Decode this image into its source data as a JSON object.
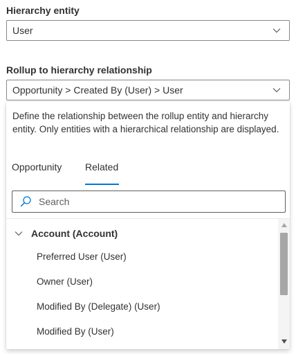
{
  "hierarchy_entity": {
    "label": "Hierarchy entity",
    "value": "User",
    "chevron_icon": "chevron-down-icon"
  },
  "rollup_relationship": {
    "label": "Rollup to hierarchy relationship",
    "value": "Opportunity > Created By (User) > User",
    "chevron_icon": "chevron-down-icon"
  },
  "flyout": {
    "description": "Define the relationship between the rollup entity and hierarchy entity. Only entities with a hierarchical relationship are displayed.",
    "tabs": [
      {
        "label": "Opportunity",
        "active": false
      },
      {
        "label": "Related",
        "active": true
      }
    ],
    "search": {
      "placeholder": "Search",
      "icon": "search-icon"
    },
    "groups": [
      {
        "label": "Account (Account)",
        "expanded": true,
        "items": [
          {
            "label": "Preferred User (User)"
          },
          {
            "label": "Owner (User)"
          },
          {
            "label": "Modified By (Delegate) (User)"
          },
          {
            "label": "Modified By (User)"
          }
        ]
      }
    ]
  },
  "colors": {
    "accent": "#0078d4",
    "text": "#323130",
    "border": "#8a8886",
    "scroll_thumb": "#a6a6a6"
  }
}
